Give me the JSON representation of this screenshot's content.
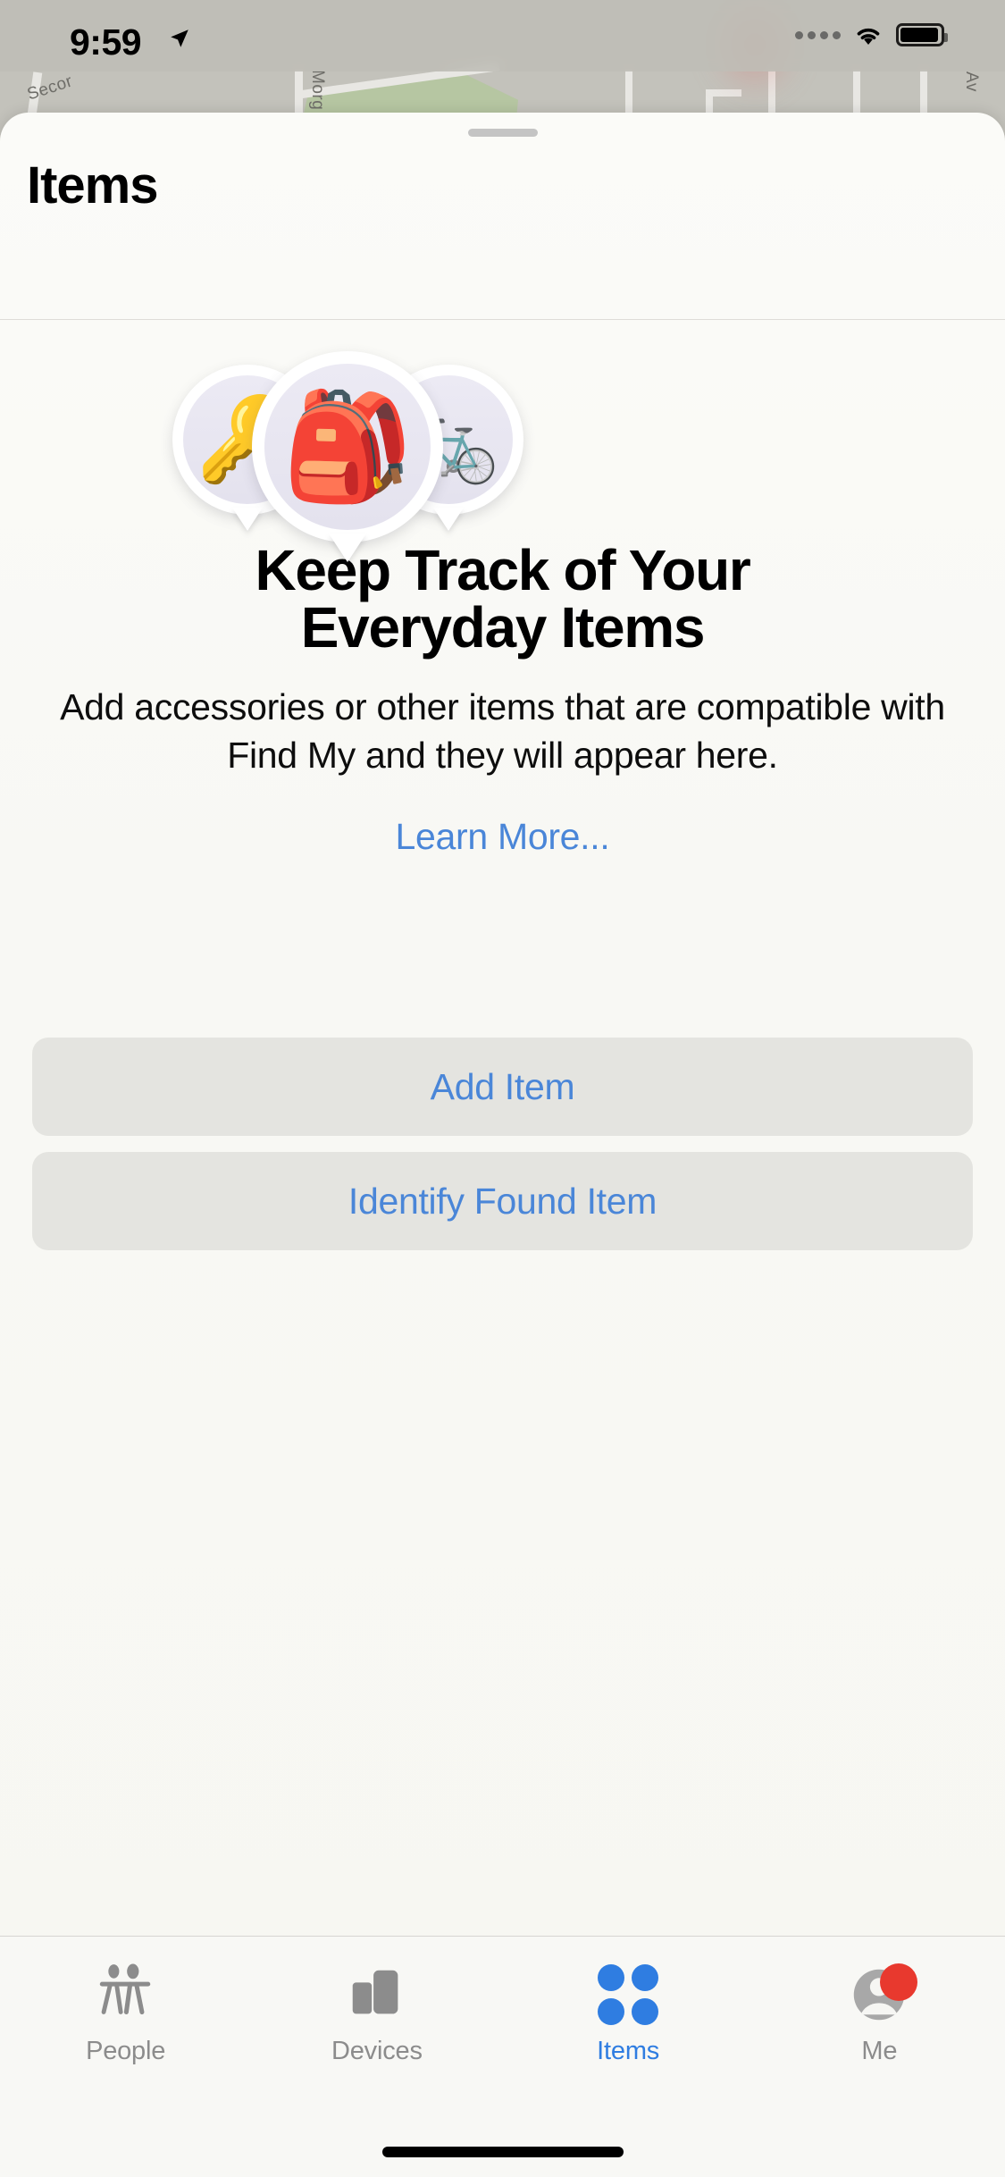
{
  "status_bar": {
    "time": "9:59",
    "location_arrow": "location-arrow-icon",
    "signal": "signal-dots-icon",
    "wifi": "wifi-icon",
    "battery": "battery-icon"
  },
  "map": {
    "labels": {
      "street_1": "Secor",
      "street_2": "Morg",
      "street_3": "Av"
    }
  },
  "sheet": {
    "grabber": "sheet-grabber",
    "title": "Items"
  },
  "empty_state": {
    "pins": [
      {
        "name": "key-pin",
        "emoji": "🔑"
      },
      {
        "name": "backpack-pin",
        "emoji": "🎒"
      },
      {
        "name": "bicycle-pin",
        "emoji": "🚲"
      }
    ],
    "headline_line_1": "Keep Track of Your",
    "headline_line_2": "Everyday Items",
    "body": "Add accessories or other items that are compatible with Find My and they will appear here.",
    "learn_more": "Learn More..."
  },
  "actions": {
    "add_item": "Add Item",
    "identify_found_item": "Identify Found Item"
  },
  "tabbar": {
    "tabs": [
      {
        "label": "People",
        "icon": "people-icon",
        "active": false
      },
      {
        "label": "Devices",
        "icon": "devices-icon",
        "active": false
      },
      {
        "label": "Items",
        "icon": "items-icon",
        "active": true
      },
      {
        "label": "Me",
        "icon": "me-avatar-icon",
        "active": false,
        "badge": true
      }
    ]
  },
  "colors": {
    "accent_blue": "#4a86d8",
    "tab_active_blue": "#2f7de1",
    "badge_red": "#e8392e",
    "button_bg": "#e4e4e0"
  }
}
